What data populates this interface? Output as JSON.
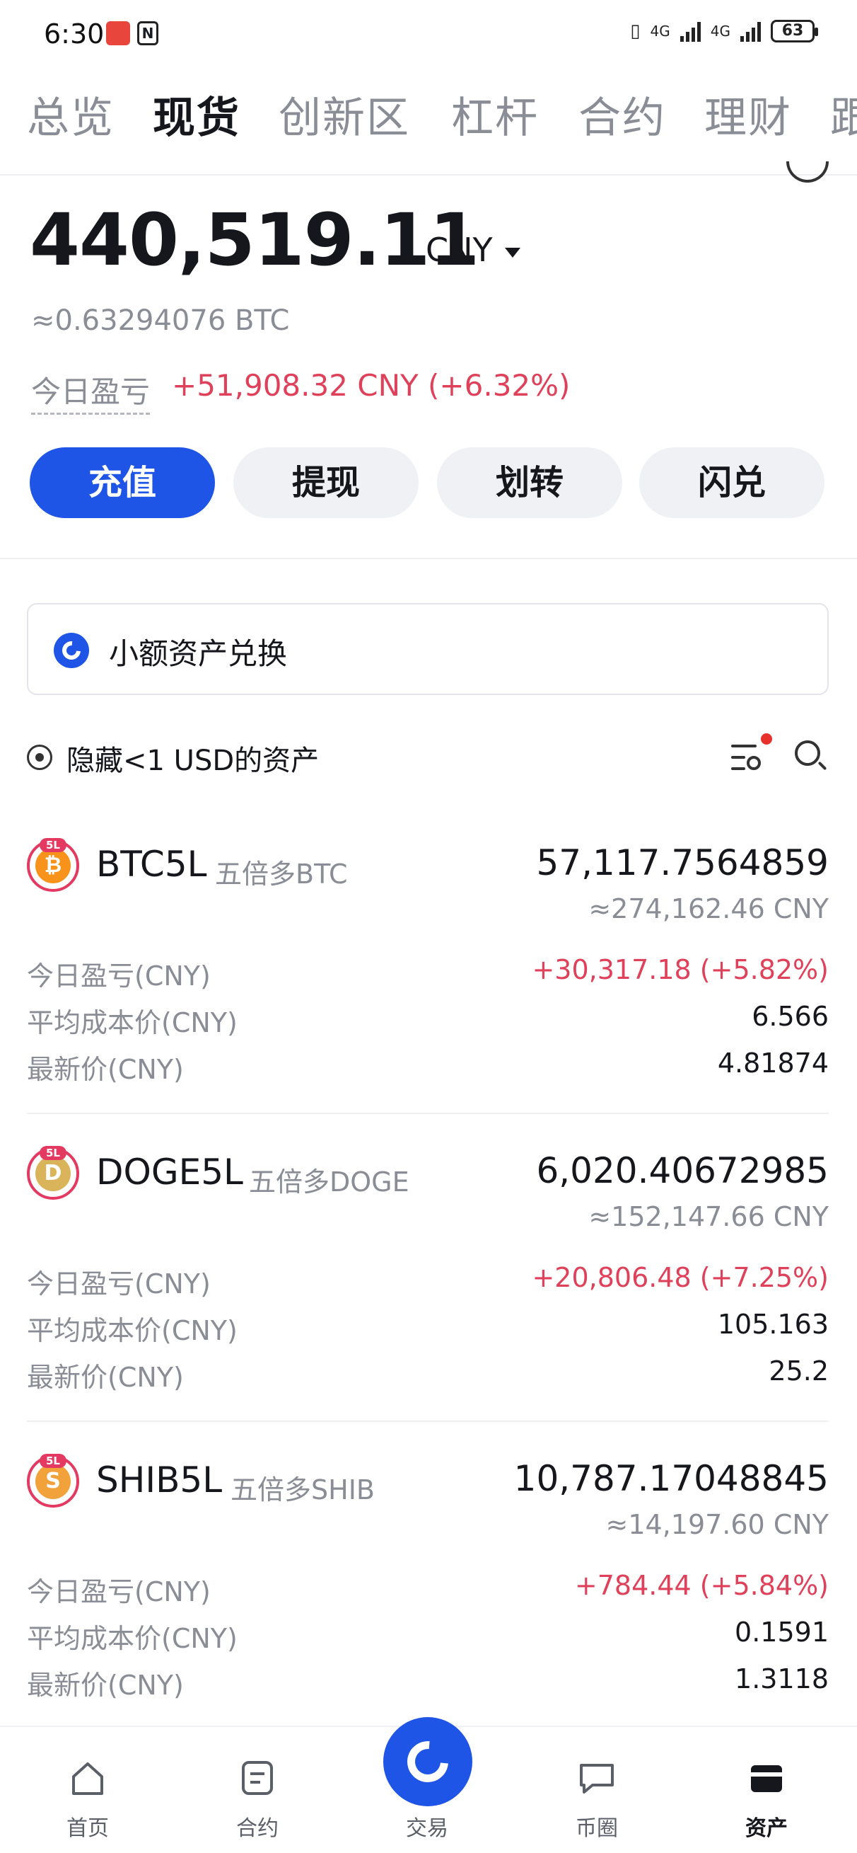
{
  "status_bar": {
    "time": "6:30",
    "battery": "63",
    "network": "4G"
  },
  "tabs": [
    "总览",
    "现货",
    "创新区",
    "杠杆",
    "合约",
    "理财",
    "跟"
  ],
  "active_tab": "现货",
  "summary": {
    "total": "440,519.11",
    "currency": "CNY",
    "btc_equiv": "≈0.63294076  BTC",
    "pnl_label": "今日盈亏",
    "pnl_value": "+51,908.32 CNY (+6.32%)"
  },
  "actions": {
    "deposit": "充值",
    "withdraw": "提现",
    "transfer": "划转",
    "convert": "闪兑"
  },
  "small_asset_card": {
    "label": "小额资产兑换"
  },
  "filter": {
    "hide_small": "隐藏<1 USD的资产"
  },
  "assets": [
    {
      "symbol": "BTC5L",
      "desc": "五倍多BTC",
      "quantity": "57,117.7564859",
      "approx": "≈274,162.46 CNY",
      "pnl_label": "今日盈亏(CNY)",
      "pnl": "+30,317.18 (+5.82%)",
      "cost_label": "平均成本价(CNY)",
      "cost": "6.566",
      "price_label": "最新价(CNY)",
      "price": "4.81874",
      "color": "#f7931a",
      "glyph": "₿"
    },
    {
      "symbol": "DOGE5L",
      "desc": "五倍多DOGE",
      "quantity": "6,020.40672985",
      "approx": "≈152,147.66 CNY",
      "pnl_label": "今日盈亏(CNY)",
      "pnl": "+20,806.48 (+7.25%)",
      "cost_label": "平均成本价(CNY)",
      "cost": "105.163",
      "price_label": "最新价(CNY)",
      "price": "25.2",
      "color": "#d9b45a",
      "glyph": "D"
    },
    {
      "symbol": "SHIB5L",
      "desc": "五倍多SHIB",
      "quantity": "10,787.17048845",
      "approx": "≈14,197.60 CNY",
      "pnl_label": "今日盈亏(CNY)",
      "pnl": "+784.44 (+5.84%)",
      "cost_label": "平均成本价(CNY)",
      "cost": "0.1591",
      "price_label": "最新价(CNY)",
      "price": "1.3118",
      "color": "#f2a23a",
      "glyph": "S"
    }
  ],
  "bottom_nav": [
    "首页",
    "合约",
    "交易",
    "币圈",
    "资产"
  ],
  "colors": {
    "accent": "#1f55e6",
    "positive": "#e0415a",
    "muted": "#8a8d95"
  }
}
